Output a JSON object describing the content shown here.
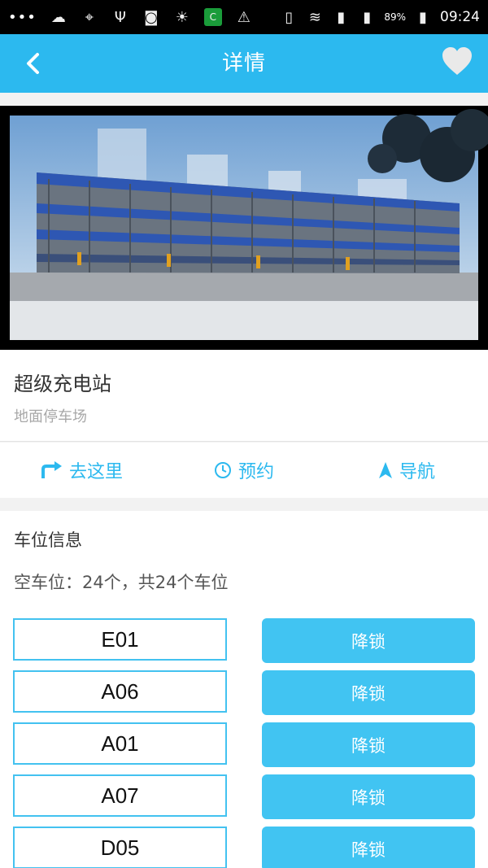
{
  "status_bar": {
    "battery": "89%",
    "time": "09:24"
  },
  "app_bar": {
    "title": "详情",
    "back_icon": "chevron-left-icon",
    "favorite_icon": "heart-icon"
  },
  "station": {
    "name": "超级充电站",
    "type": "地面停车场"
  },
  "actions": [
    {
      "label": "去这里",
      "icon": "turn-right-arrow-icon"
    },
    {
      "label": "预约",
      "icon": "clock-icon"
    },
    {
      "label": "导航",
      "icon": "navigation-arrow-icon"
    }
  ],
  "parking": {
    "title": "车位信息",
    "summary": "空车位：24个，共24个车位",
    "spots": [
      {
        "code": "E01",
        "button": "降锁"
      },
      {
        "code": "A06",
        "button": "降锁"
      },
      {
        "code": "A01",
        "button": "降锁"
      },
      {
        "code": "A07",
        "button": "降锁"
      },
      {
        "code": "D05",
        "button": "降锁"
      }
    ]
  },
  "colors": {
    "accent": "#2cb9ef",
    "button": "#41c4f2"
  }
}
